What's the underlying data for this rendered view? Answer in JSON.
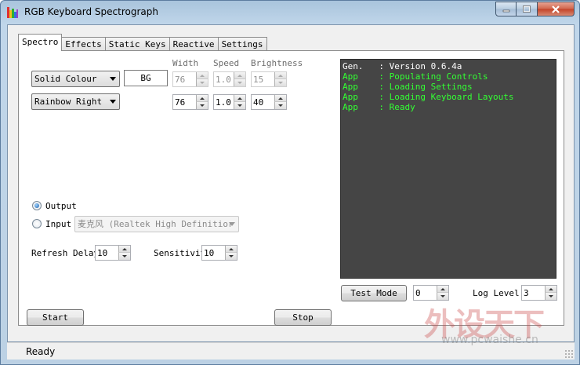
{
  "window": {
    "title": "RGB Keyboard Spectrograph",
    "status": "Ready"
  },
  "tabs": [
    "Spectro",
    "Effects",
    "Static Keys",
    "Reactive",
    "Settings"
  ],
  "active_tab": "Spectro",
  "spectro": {
    "headers": {
      "width": "Width",
      "speed": "Speed",
      "brightness": "Brightness"
    },
    "row1": {
      "mode": "Solid Colour",
      "color_label": "BG",
      "width": "76",
      "speed": "1.0",
      "brightness": "15"
    },
    "row2": {
      "mode": "Rainbow Right",
      "width": "76",
      "speed": "1.0",
      "brightness": "40"
    },
    "source": {
      "output_label": "Output",
      "input_label": "Input",
      "input_device": "麦克风 (Realtek High Definitior",
      "selected": "Output"
    },
    "refresh_delay_label": "Refresh Delay:",
    "refresh_delay": "10",
    "sensitivity_label": "Sensitivit:",
    "sensitivity": "10",
    "start_label": "Start",
    "stop_label": "Stop"
  },
  "log": {
    "lines": [
      {
        "source": "Gen.",
        "message": "Version 0.6.4a",
        "color": "#ffffff"
      },
      {
        "source": "App",
        "message": "Populating Controls",
        "color": "#33ff33"
      },
      {
        "source": "App",
        "message": "Loading Settings",
        "color": "#33ff33"
      },
      {
        "source": "App",
        "message": "Loading Keyboard Layouts",
        "color": "#33ff33"
      },
      {
        "source": "App",
        "message": "Ready",
        "color": "#33ff33"
      }
    ]
  },
  "test": {
    "button_label": "Test Mode",
    "value": "0",
    "log_level_label": "Log Level:",
    "log_level": "3"
  },
  "watermark": {
    "text": "外设天下",
    "url": "www.pcwaishe.cn"
  },
  "colors": {
    "log_bg": "#454545",
    "log_green": "#33ff33"
  }
}
